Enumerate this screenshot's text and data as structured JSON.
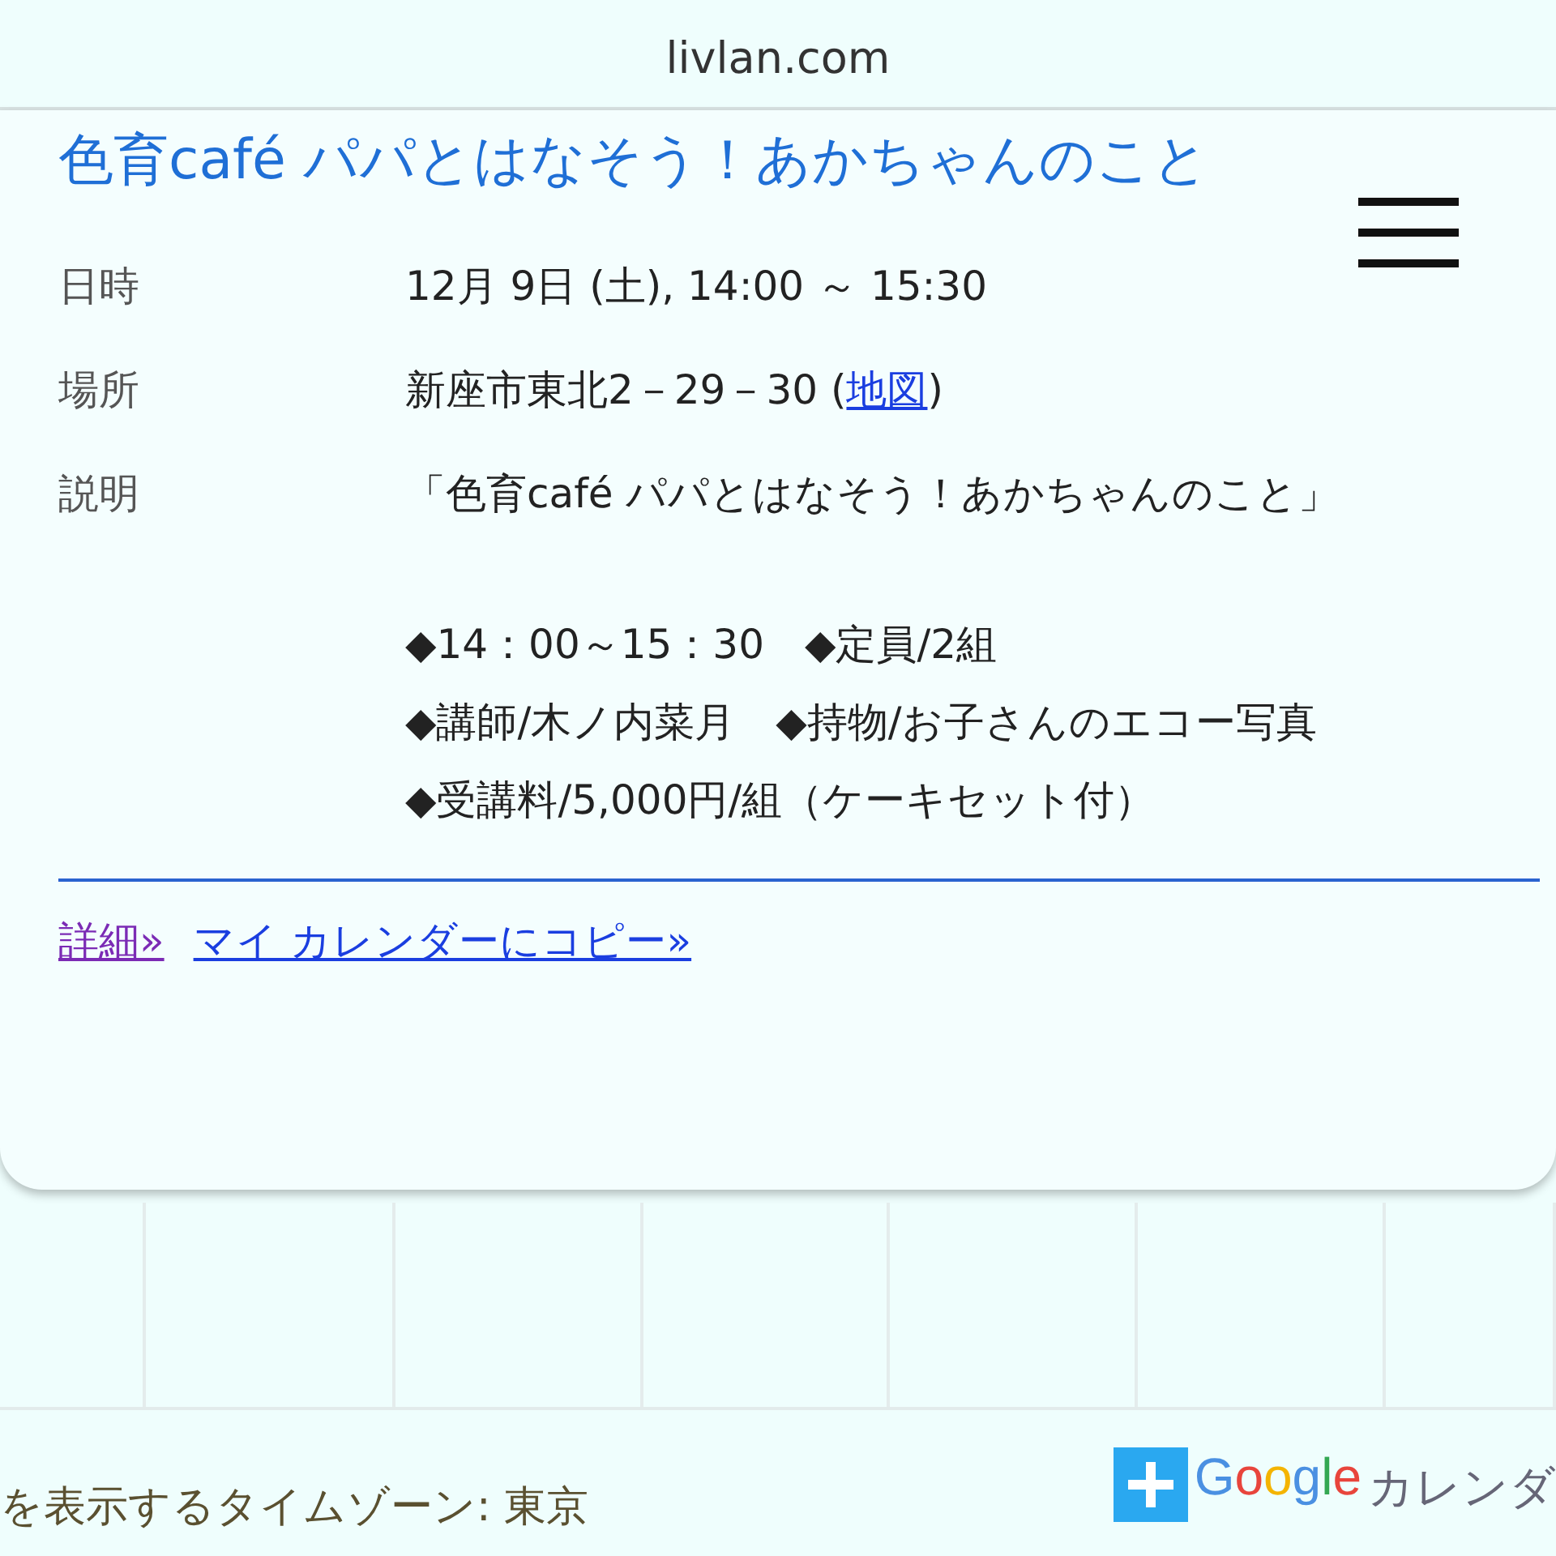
{
  "address_bar": {
    "url": "livlan.com"
  },
  "event": {
    "title": "色育café パパとはなそう！あかちゃんのこと",
    "rows": [
      {
        "kind": "text",
        "label": "日時",
        "value": "12月 9日 (土), 14:00 ～ 15:30"
      },
      {
        "kind": "location",
        "label": "場所",
        "value": "新座市東北2－29－30 (",
        "link": "地図",
        "suffix": ")"
      },
      {
        "kind": "description",
        "label": "説明",
        "value": "「色育café パパとはなそう！あかちゃんのこと」",
        "lines": [
          "◆14：00～15：30　◆定員/2組",
          "◆講師/木ノ内菜月　◆持物/お子さんのエコー写真",
          "◆受講料/5,000円/組（ケーキセット付）"
        ]
      }
    ],
    "links": [
      {
        "label": "詳細»",
        "visited": true
      },
      {
        "label": "マイ カレンダーにコピー»",
        "visited": false
      }
    ]
  },
  "footer": {
    "timezone": "を表示するタイムゾーン: 東京",
    "badge_brand": "Google",
    "badge_label": "カレンダ"
  }
}
